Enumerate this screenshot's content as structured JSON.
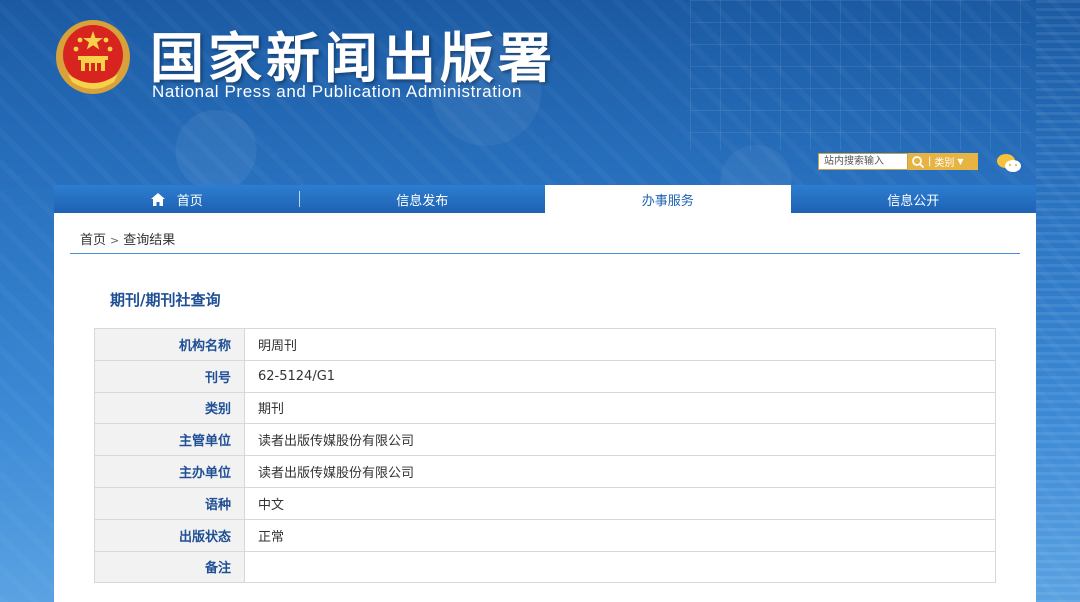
{
  "header": {
    "title_cn": "国家新闻出版署",
    "title_en": "National  Press and Publication Administration"
  },
  "search": {
    "placeholder": "站内搜索输入",
    "category_label": "类别",
    "icon": "search-icon"
  },
  "nav": {
    "items": [
      {
        "label": "首页",
        "icon": "home-icon"
      },
      {
        "label": "信息发布"
      },
      {
        "label": "办事服务",
        "active": true
      },
      {
        "label": "信息公开"
      }
    ]
  },
  "breadcrumb": {
    "home": "首页",
    "separator": ">",
    "current": "查询结果"
  },
  "section_title": "期刊/期刊社查询",
  "table": {
    "rows": [
      {
        "label": "机构名称",
        "value": "明周刊"
      },
      {
        "label": "刊号",
        "value": "62-5124/G1"
      },
      {
        "label": "类别",
        "value": "期刊"
      },
      {
        "label": "主管单位",
        "value": "读者出版传媒股份有限公司"
      },
      {
        "label": "主办单位",
        "value": "读者出版传媒股份有限公司"
      },
      {
        "label": "语种",
        "value": "中文"
      },
      {
        "label": "出版状态",
        "value": "正常"
      },
      {
        "label": "备注",
        "value": ""
      }
    ]
  },
  "colors": {
    "brand_blue": "#1e62b3",
    "label_blue": "#1f4f94",
    "search_gold": "#e7b443"
  }
}
